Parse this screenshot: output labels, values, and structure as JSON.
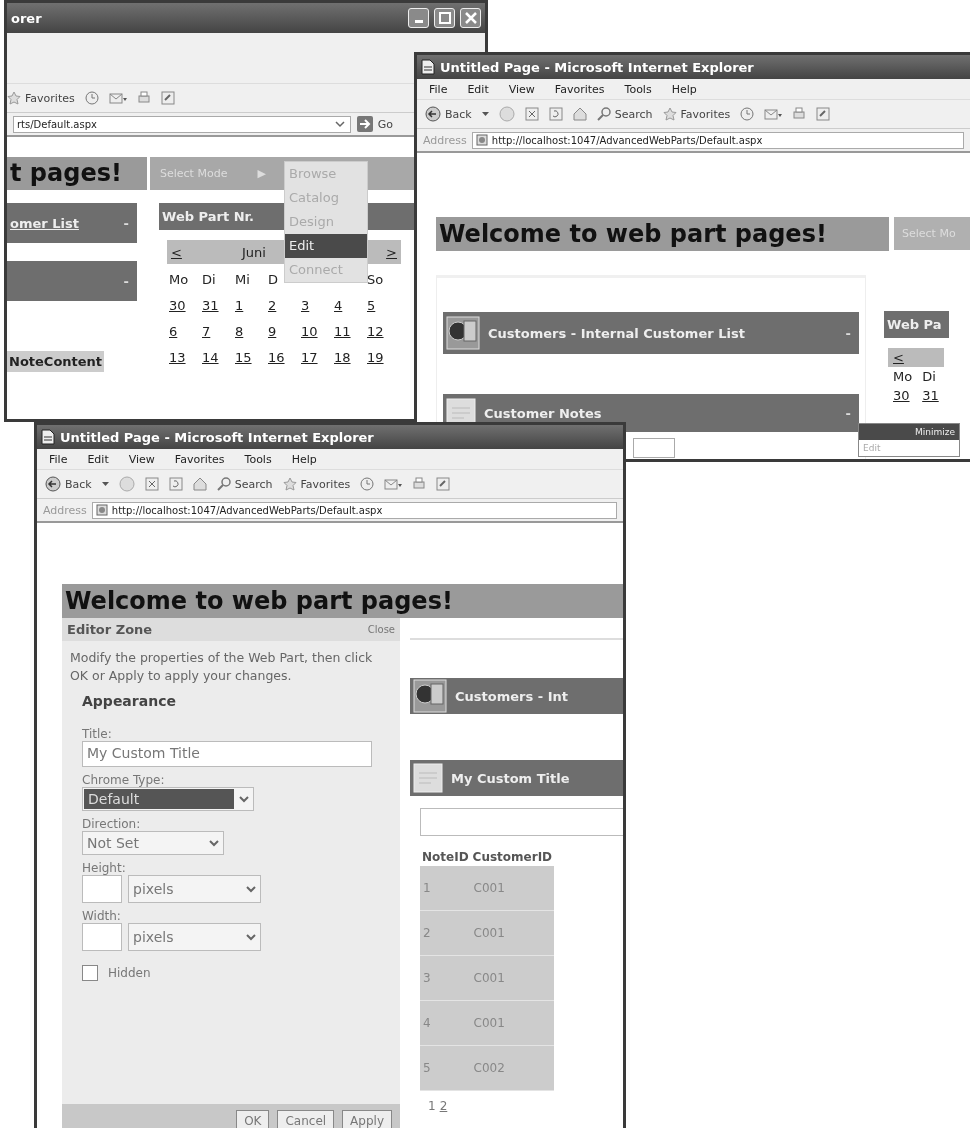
{
  "back_window": {
    "title": "orer",
    "toolbar": {
      "favorites": "Favorites"
    },
    "address": "rts/Default.aspx",
    "go": "Go",
    "heading": "t pages!",
    "mode_label": "Select Mode",
    "mode_arrow": "▶",
    "mode_menu": [
      {
        "label": "Browse",
        "selected": false
      },
      {
        "label": "Catalog",
        "selected": false
      },
      {
        "label": "Design",
        "selected": false
      },
      {
        "label": "Edit",
        "selected": true
      },
      {
        "label": "Connect",
        "selected": false
      }
    ],
    "parts": [
      {
        "title": "omer List",
        "verb": "-"
      },
      {
        "verb": "-"
      }
    ],
    "note_header": "NoteContent",
    "calendar": {
      "part_title": "Web Part Nr.",
      "prev": "<",
      "month": "Juni",
      "next": ">",
      "days_left": [
        "Mo",
        "Di",
        "Mi",
        "D"
      ],
      "days_right": [
        "So"
      ],
      "weeks": [
        [
          "30",
          "31",
          "1",
          "2",
          "3",
          "4",
          "5"
        ],
        [
          "6",
          "7",
          "8",
          "9",
          "10",
          "11",
          "12"
        ],
        [
          "13",
          "14",
          "15",
          "16",
          "17",
          "18",
          "19"
        ]
      ]
    }
  },
  "middle_window": {
    "title": "Untitled Page - Microsoft Internet Explorer",
    "menu": [
      "File",
      "Edit",
      "View",
      "Favorites",
      "Tools",
      "Help"
    ],
    "toolbar": {
      "back": "Back",
      "search": "Search",
      "favorites": "Favorites"
    },
    "address_label": "Address",
    "address": "http://localhost:1047/AdvancedWebParts/Default.aspx",
    "heading": "Welcome to web part pages!",
    "mode_label": "Select Mo",
    "parts": [
      {
        "title": "Customers - Internal Customer List",
        "verb": "-"
      },
      {
        "title": "Customer Notes",
        "verb": "-"
      }
    ],
    "calendar": {
      "part_title": "Web Pa",
      "prev": "<",
      "days": [
        "Mo",
        "Di"
      ],
      "dates": [
        "30",
        "31"
      ]
    },
    "verb_menu": [
      {
        "label": "Minimize",
        "selected": true
      },
      {
        "label": "Edit",
        "selected": false
      }
    ]
  },
  "front_window": {
    "title": "Untitled Page - Microsoft Internet Explorer",
    "menu": [
      "File",
      "Edit",
      "View",
      "Favorites",
      "Tools",
      "Help"
    ],
    "toolbar": {
      "back": "Back",
      "search": "Search",
      "favorites": "Favorites"
    },
    "address_label": "Address",
    "address": "http://localhost:1047/AdvancedWebParts/Default.aspx",
    "heading": "Welcome to web part pages!",
    "editor": {
      "title": "Editor Zone",
      "close": "Close",
      "description": "Modify the properties of the Web Part, then click OK or Apply to apply your changes.",
      "section": "Appearance",
      "fields": [
        {
          "kind": "text",
          "label": "Title:",
          "value": "My Custom Title"
        },
        {
          "kind": "select",
          "label": "Chrome Type:",
          "value": "Default",
          "selected": true
        },
        {
          "kind": "select",
          "label": "Direction:",
          "value": "Not Set",
          "selected": false
        },
        {
          "kind": "size",
          "label": "Height:",
          "unit": "pixels"
        },
        {
          "kind": "size",
          "label": "Width:",
          "unit": "pixels"
        },
        {
          "kind": "checkbox",
          "label": "Hidden",
          "checked": false
        }
      ],
      "buttons": [
        "OK",
        "Cancel",
        "Apply"
      ]
    },
    "parts": [
      {
        "title": "Customers - Int"
      },
      {
        "title": "My Custom Title"
      }
    ],
    "table": {
      "columns": [
        "NoteID",
        "CustomerID"
      ],
      "rows": [
        [
          "1",
          "C001"
        ],
        [
          "2",
          "C001"
        ],
        [
          "3",
          "C001"
        ],
        [
          "4",
          "C001"
        ],
        [
          "5",
          "C002"
        ]
      ]
    },
    "pager": [
      {
        "label": "1",
        "selected": true
      },
      {
        "label": "2",
        "selected": false
      }
    ]
  }
}
